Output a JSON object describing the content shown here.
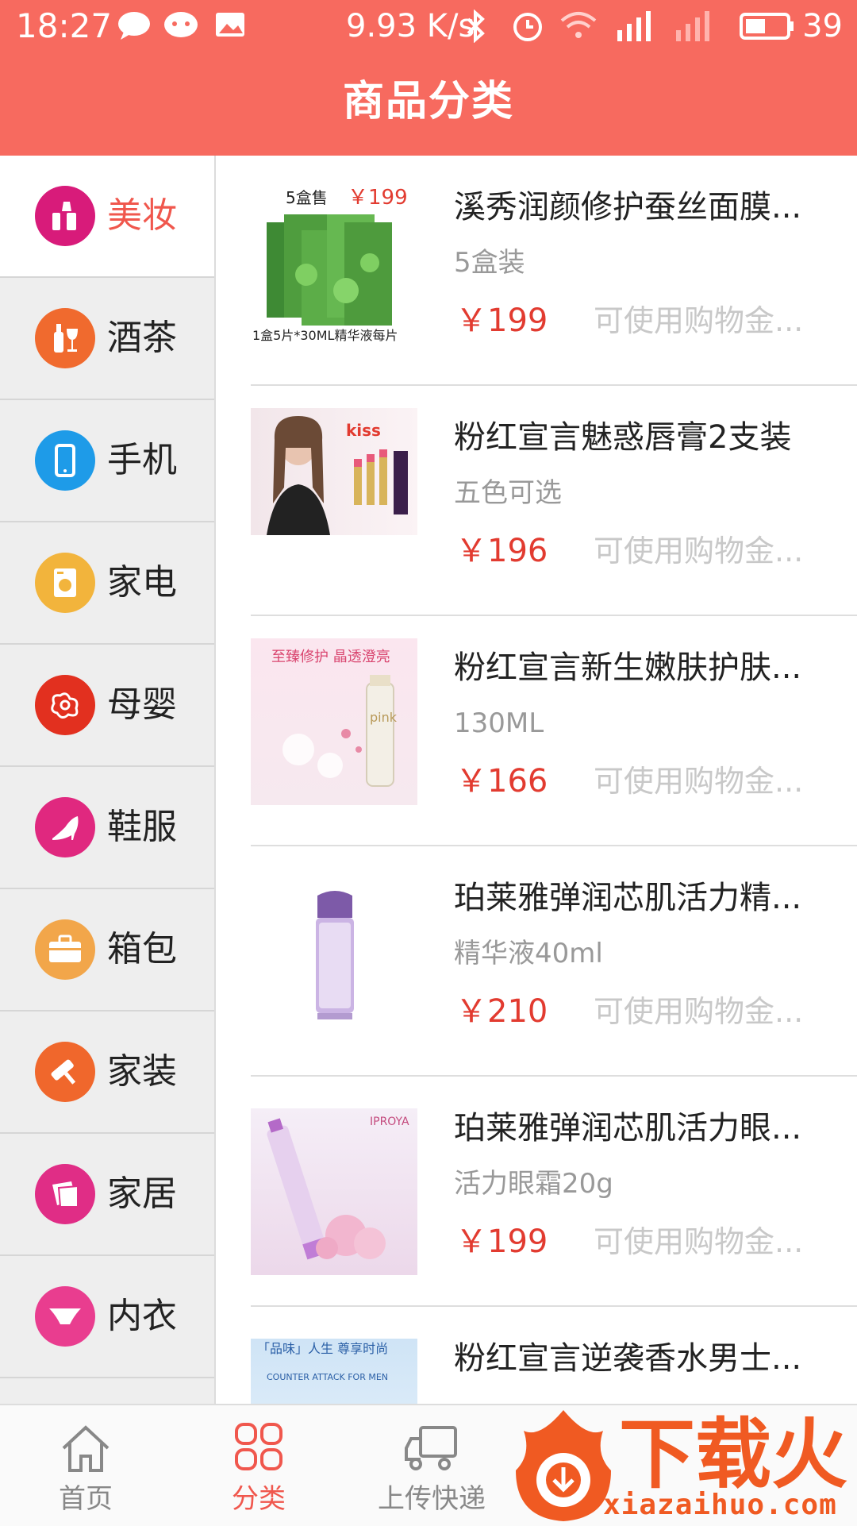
{
  "status_bar": {
    "time": "18:27",
    "network_speed": "9.93 K/s",
    "battery": "39"
  },
  "header": {
    "title": "商品分类"
  },
  "categories": [
    {
      "label": "美妆",
      "icon": "makeup-icon",
      "color": "#d81b7a",
      "active": true
    },
    {
      "label": "酒茶",
      "icon": "wine-icon",
      "color": "#f06a2e"
    },
    {
      "label": "手机",
      "icon": "phone-icon",
      "color": "#1e9be8"
    },
    {
      "label": "家电",
      "icon": "washer-icon",
      "color": "#f2b43c"
    },
    {
      "label": "母婴",
      "icon": "baby-icon",
      "color": "#e2301f"
    },
    {
      "label": "鞋服",
      "icon": "high-heel-icon",
      "color": "#e0287f"
    },
    {
      "label": "箱包",
      "icon": "suitcase-icon",
      "color": "#f2a64a"
    },
    {
      "label": "家装",
      "icon": "paint-roller-icon",
      "color": "#f0672c"
    },
    {
      "label": "家居",
      "icon": "pillow-icon",
      "color": "#e02d86"
    },
    {
      "label": "内衣",
      "icon": "underwear-icon",
      "color": "#e93d8f"
    }
  ],
  "products": [
    {
      "name": "溪秀润颜修护蚕丝面膜...",
      "spec": "5盒装",
      "price": "￥199",
      "note": "可使用购物金...",
      "thumb_text_top": "5盒售",
      "thumb_price": "￥199",
      "thumb_text_bottom": "1盒5片*30ML精华液每片"
    },
    {
      "name": "粉红宣言魅惑唇膏2支装",
      "spec": "五色可选",
      "price": "￥196",
      "note": "可使用购物金...",
      "thumb_text": "kiss"
    },
    {
      "name": "粉红宣言新生嫩肤护肤...",
      "spec": "130ML",
      "price": "￥166",
      "note": "可使用购物金...",
      "thumb_text": "至臻修护 晶透澄亮",
      "thumb_brand": "pink"
    },
    {
      "name": "珀莱雅弹润芯肌活力精...",
      "spec": "精华液40ml",
      "price": "￥210",
      "note": "可使用购物金..."
    },
    {
      "name": "珀莱雅弹润芯肌活力眼...",
      "spec": "活力眼霜20g",
      "price": "￥199",
      "note": "可使用购物金...",
      "thumb_text": "IPROYA"
    },
    {
      "name": "粉红宣言逆袭香水男士...",
      "spec": "",
      "price": "",
      "note": "",
      "thumb_text": "「品味」人生 尊享时尚",
      "thumb_sub": "COUNTER ATTACK FOR MEN"
    }
  ],
  "tabs": [
    {
      "label": "首页",
      "icon": "home-icon"
    },
    {
      "label": "分类",
      "icon": "grid-icon",
      "active": true
    },
    {
      "label": "上传快递",
      "icon": "truck-icon"
    }
  ],
  "watermark": {
    "text": "下载火",
    "url": "xiazaihuo.com"
  },
  "colors": {
    "accent": "#f76a5f",
    "price": "#e23b30"
  }
}
